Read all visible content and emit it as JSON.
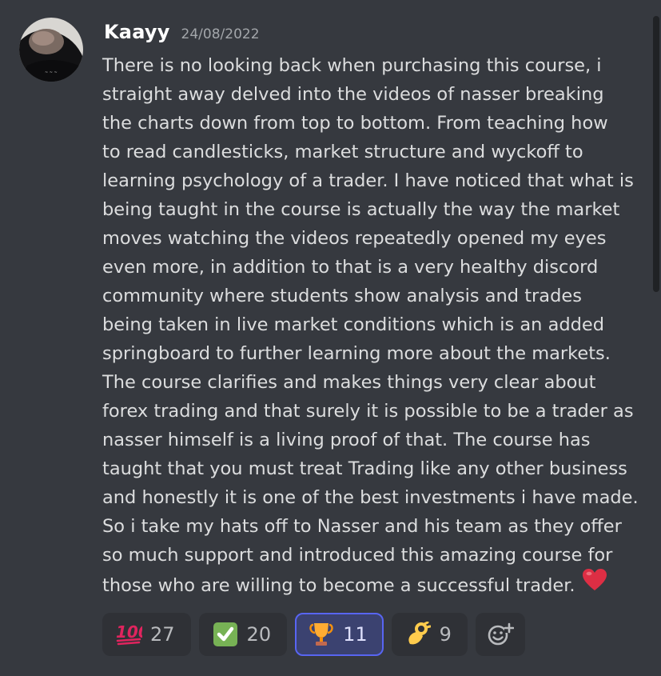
{
  "message": {
    "username": "Kaayy",
    "timestamp": "24/08/2022",
    "text": "There is no looking back when purchasing this course, i\nstraight away delved into the videos of nasser breaking\nthe charts down from top to bottom. From teaching how\nto read candlesticks, market structure and wyckoff to\nlearning psychology of a trader. I have noticed that what is\nbeing taught in the course is actually the way the market\nmoves watching the videos repeatedly opened my eyes\neven more, in addition to that is a very healthy discord\ncommunity where students show analysis and trades\nbeing taken in live market conditions which is an added\nspringboard to further learning more about the markets.\nThe course clarifies and makes things very clear about\nforex trading and that surely it is possible to be a trader as\nnasser himself is a living proof of that. The course has\ntaught that you must treat Trading like any other business\nand honestly it is one of the best investments i have made.\nSo i take my hats off to Nasser and his team as they offer\nso much support and introduced this amazing course for\nthose who are willing to become a successful trader.",
    "trailing_emoji": "heart-icon"
  },
  "reactions": [
    {
      "icon": "hundred-points-icon",
      "count": "27",
      "active": false
    },
    {
      "icon": "check-mark-icon",
      "count": "20",
      "active": false
    },
    {
      "icon": "trophy-icon",
      "count": "11",
      "active": true
    },
    {
      "icon": "ok-hand-icon",
      "count": "9",
      "active": false
    }
  ],
  "add_reaction_icon": "add-reaction-icon",
  "colors": {
    "background": "#36393f",
    "reaction_bg": "#2f3136",
    "reaction_active_bg": "#3b4270",
    "reaction_active_border": "#5865f2",
    "username": "#ffffff",
    "text": "#dcddde"
  }
}
